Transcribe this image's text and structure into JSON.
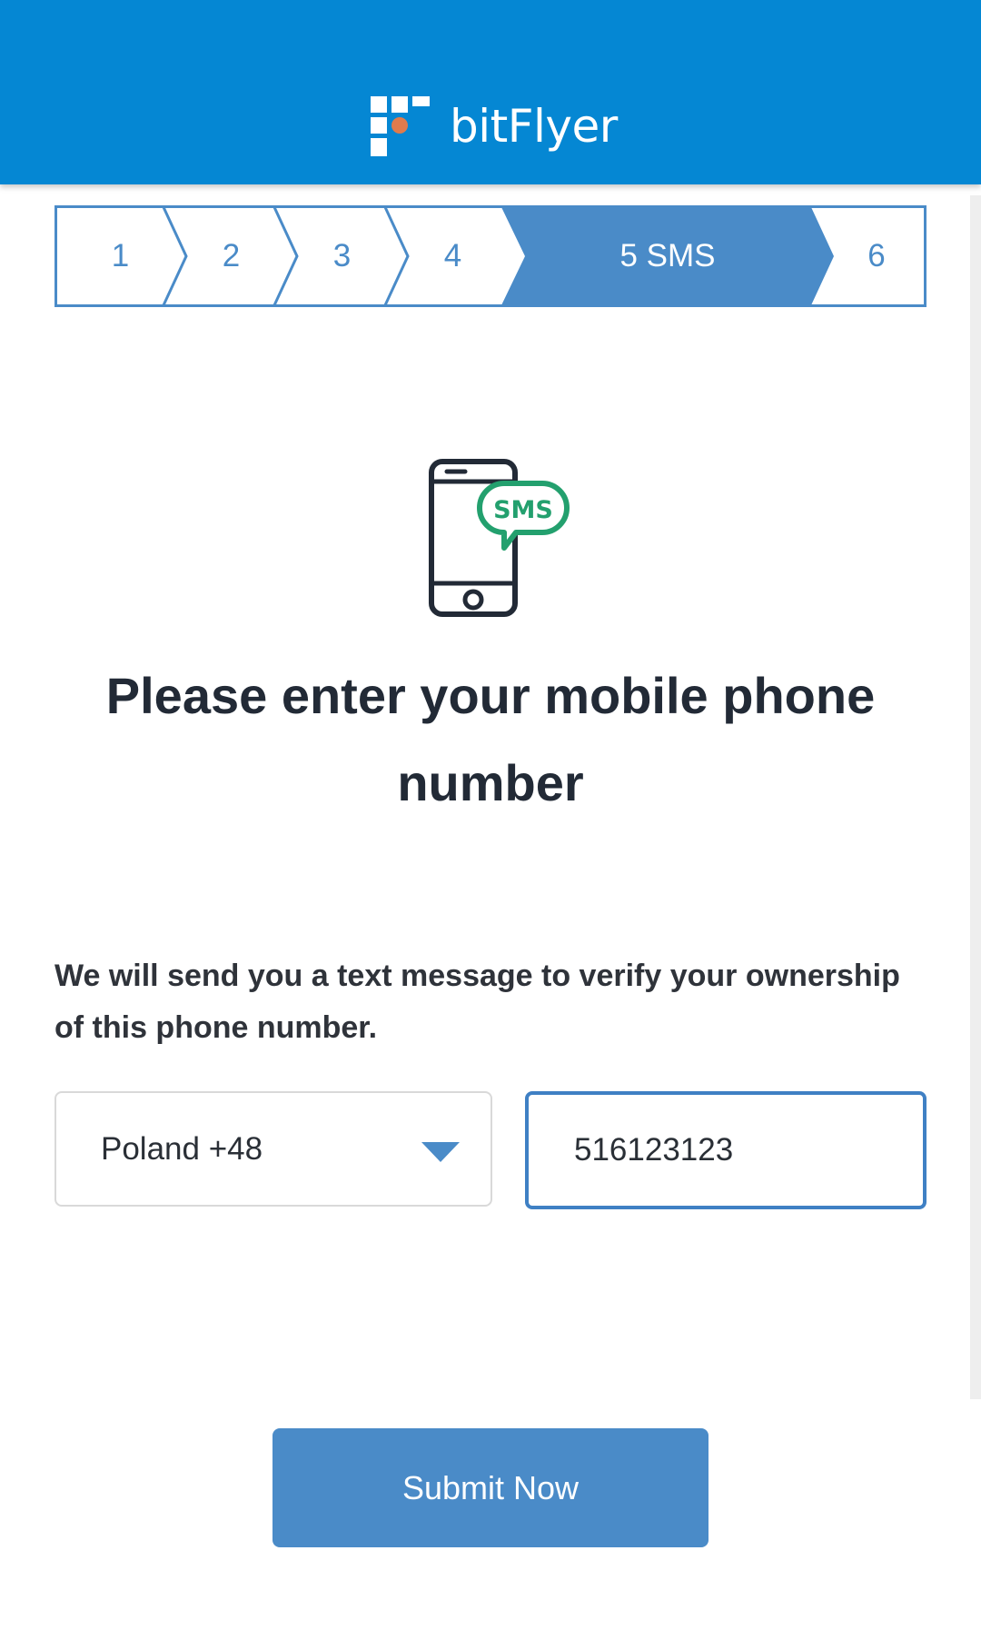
{
  "header": {
    "brand": "bitFlyer",
    "background_color": "#0587d3",
    "logo_accent_color": "#e07b4c"
  },
  "stepper": {
    "steps": [
      {
        "label": "1",
        "active": false
      },
      {
        "label": "2",
        "active": false
      },
      {
        "label": "3",
        "active": false
      },
      {
        "label": "4",
        "active": false
      },
      {
        "label": "5 SMS",
        "active": true
      },
      {
        "label": "6",
        "active": false
      }
    ],
    "active_color": "#4a8bc8"
  },
  "hero": {
    "icon": "phone-sms-icon",
    "bubble_text": "SMS",
    "bubble_color": "#23a06e"
  },
  "main": {
    "title": "Please enter your mobile phone number",
    "description": "We will send you a text message to verify your ownership of this phone number."
  },
  "form": {
    "country_select": {
      "value": "Poland +48",
      "icon": "chevron-down-icon"
    },
    "phone_input": {
      "value": "516123123"
    }
  },
  "actions": {
    "submit_label": "Submit Now",
    "button_color": "#4a8bc8"
  }
}
